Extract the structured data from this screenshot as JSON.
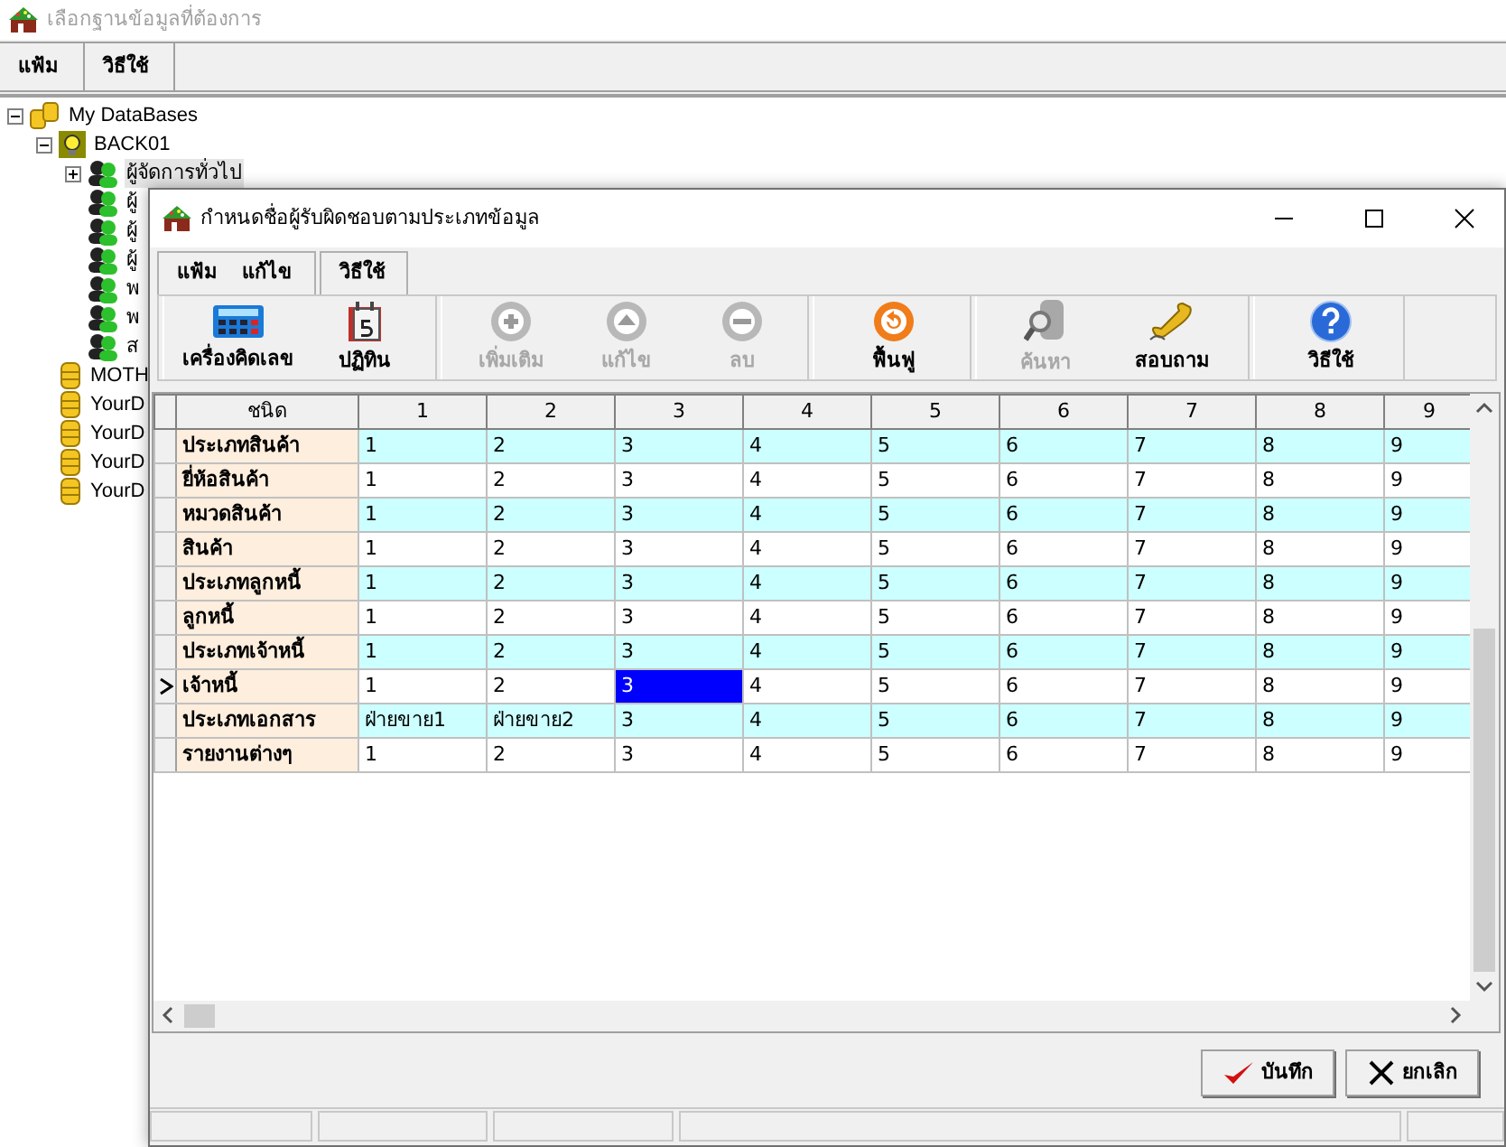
{
  "window": {
    "title": "เลือกฐานข้อมูลที่ต้องการ",
    "menu": [
      {
        "label": "แฟ้ม"
      },
      {
        "label": "วิธีใช้"
      }
    ]
  },
  "tree": [
    {
      "label": "My DataBases",
      "kind": "databases",
      "expanded": true,
      "children": [
        {
          "label": "BACK01",
          "kind": "server",
          "expanded": true,
          "children": [
            {
              "label": "ผู้จัดการทั่วไป",
              "kind": "user",
              "selected": true,
              "expanded": false
            },
            {
              "label": "ผู้",
              "kind": "user",
              "selected": false
            },
            {
              "label": "ผู้",
              "kind": "user",
              "selected": false
            },
            {
              "label": "ผู้",
              "kind": "user",
              "selected": false
            },
            {
              "label": "พ",
              "kind": "user",
              "selected": false
            },
            {
              "label": "พ",
              "kind": "user",
              "selected": false
            },
            {
              "label": "ส",
              "kind": "user",
              "selected": false
            }
          ]
        },
        {
          "label": "MOTH",
          "kind": "database"
        },
        {
          "label": "YourD",
          "kind": "database"
        },
        {
          "label": "YourD",
          "kind": "database"
        },
        {
          "label": "YourD",
          "kind": "database"
        },
        {
          "label": "YourD",
          "kind": "database"
        }
      ]
    }
  ],
  "dialog": {
    "title": "กำหนดชื่อผู้รับผิดชอบตามประเภทข้อมูล",
    "menu": [
      {
        "items": [
          "แฟ้ม",
          "แก้ไข"
        ]
      },
      {
        "items": [
          "วิธีใช้"
        ]
      }
    ],
    "toolbar": [
      [
        {
          "label": "เครื่องคิดเลข",
          "disabled": false
        },
        {
          "label": "ปฏิทิน",
          "disabled": false
        }
      ],
      [
        {
          "label": "เพิ่มเติม",
          "disabled": true
        },
        {
          "label": "แก้ไข",
          "disabled": true
        },
        {
          "label": "ลบ",
          "disabled": true
        }
      ],
      [
        {
          "label": "ฟื้นฟู",
          "disabled": false
        }
      ],
      [
        {
          "label": "ค้นหา",
          "disabled": true
        },
        {
          "label": "สอบถาม",
          "disabled": false
        }
      ],
      [
        {
          "label": "วิธีใช้",
          "disabled": false
        }
      ]
    ],
    "table": {
      "label_column": "ชนิด",
      "columns": [
        "1",
        "2",
        "3",
        "4",
        "5",
        "6",
        "7",
        "8",
        "9"
      ],
      "rows": [
        {
          "label": "ประเภทสินค้า",
          "current": false,
          "cells": [
            {
              "text": "1",
              "selected": false
            },
            {
              "text": "2",
              "selected": false
            },
            {
              "text": "3",
              "selected": false
            },
            {
              "text": "4",
              "selected": false
            },
            {
              "text": "5",
              "selected": false
            },
            {
              "text": "6",
              "selected": false
            },
            {
              "text": "7",
              "selected": false
            },
            {
              "text": "8",
              "selected": false
            },
            {
              "text": "9",
              "selected": false
            }
          ]
        },
        {
          "label": "ยี่ห้อสินค้า",
          "current": false,
          "cells": [
            {
              "text": "1",
              "selected": false
            },
            {
              "text": "2",
              "selected": false
            },
            {
              "text": "3",
              "selected": false
            },
            {
              "text": "4",
              "selected": false
            },
            {
              "text": "5",
              "selected": false
            },
            {
              "text": "6",
              "selected": false
            },
            {
              "text": "7",
              "selected": false
            },
            {
              "text": "8",
              "selected": false
            },
            {
              "text": "9",
              "selected": false
            }
          ]
        },
        {
          "label": "หมวดสินค้า",
          "current": false,
          "cells": [
            {
              "text": "1",
              "selected": false
            },
            {
              "text": "2",
              "selected": false
            },
            {
              "text": "3",
              "selected": false
            },
            {
              "text": "4",
              "selected": false
            },
            {
              "text": "5",
              "selected": false
            },
            {
              "text": "6",
              "selected": false
            },
            {
              "text": "7",
              "selected": false
            },
            {
              "text": "8",
              "selected": false
            },
            {
              "text": "9",
              "selected": false
            }
          ]
        },
        {
          "label": "สินค้า",
          "current": false,
          "cells": [
            {
              "text": "1",
              "selected": false
            },
            {
              "text": "2",
              "selected": false
            },
            {
              "text": "3",
              "selected": false
            },
            {
              "text": "4",
              "selected": false
            },
            {
              "text": "5",
              "selected": false
            },
            {
              "text": "6",
              "selected": false
            },
            {
              "text": "7",
              "selected": false
            },
            {
              "text": "8",
              "selected": false
            },
            {
              "text": "9",
              "selected": false
            }
          ]
        },
        {
          "label": "ประเภทลูกหนี้",
          "current": false,
          "cells": [
            {
              "text": "1",
              "selected": false
            },
            {
              "text": "2",
              "selected": false
            },
            {
              "text": "3",
              "selected": false
            },
            {
              "text": "4",
              "selected": false
            },
            {
              "text": "5",
              "selected": false
            },
            {
              "text": "6",
              "selected": false
            },
            {
              "text": "7",
              "selected": false
            },
            {
              "text": "8",
              "selected": false
            },
            {
              "text": "9",
              "selected": false
            }
          ]
        },
        {
          "label": "ลูกหนี้",
          "current": false,
          "cells": [
            {
              "text": "1",
              "selected": false
            },
            {
              "text": "2",
              "selected": false
            },
            {
              "text": "3",
              "selected": false
            },
            {
              "text": "4",
              "selected": false
            },
            {
              "text": "5",
              "selected": false
            },
            {
              "text": "6",
              "selected": false
            },
            {
              "text": "7",
              "selected": false
            },
            {
              "text": "8",
              "selected": false
            },
            {
              "text": "9",
              "selected": false
            }
          ]
        },
        {
          "label": "ประเภทเจ้าหนี้",
          "current": false,
          "cells": [
            {
              "text": "1",
              "selected": false
            },
            {
              "text": "2",
              "selected": false
            },
            {
              "text": "3",
              "selected": false
            },
            {
              "text": "4",
              "selected": false
            },
            {
              "text": "5",
              "selected": false
            },
            {
              "text": "6",
              "selected": false
            },
            {
              "text": "7",
              "selected": false
            },
            {
              "text": "8",
              "selected": false
            },
            {
              "text": "9",
              "selected": false
            }
          ]
        },
        {
          "label": "เจ้าหนี้",
          "current": true,
          "cells": [
            {
              "text": "1",
              "selected": false
            },
            {
              "text": "2",
              "selected": false
            },
            {
              "text": "3",
              "selected": true
            },
            {
              "text": "4",
              "selected": false
            },
            {
              "text": "5",
              "selected": false
            },
            {
              "text": "6",
              "selected": false
            },
            {
              "text": "7",
              "selected": false
            },
            {
              "text": "8",
              "selected": false
            },
            {
              "text": "9",
              "selected": false
            }
          ]
        },
        {
          "label": "ประเภทเอกสาร",
          "current": false,
          "cells": [
            {
              "text": "ฝ่ายขาย1",
              "selected": false
            },
            {
              "text": "ฝ่ายขาย2",
              "selected": false
            },
            {
              "text": "3",
              "selected": false
            },
            {
              "text": "4",
              "selected": false
            },
            {
              "text": "5",
              "selected": false
            },
            {
              "text": "6",
              "selected": false
            },
            {
              "text": "7",
              "selected": false
            },
            {
              "text": "8",
              "selected": false
            },
            {
              "text": "9",
              "selected": false
            }
          ]
        },
        {
          "label": "รายงานต่างๆ",
          "current": false,
          "cells": [
            {
              "text": "1",
              "selected": false
            },
            {
              "text": "2",
              "selected": false
            },
            {
              "text": "3",
              "selected": false
            },
            {
              "text": "4",
              "selected": false
            },
            {
              "text": "5",
              "selected": false
            },
            {
              "text": "6",
              "selected": false
            },
            {
              "text": "7",
              "selected": false
            },
            {
              "text": "8",
              "selected": false
            },
            {
              "text": "9",
              "selected": false
            }
          ]
        }
      ]
    },
    "buttons": [
      {
        "label": "บันทึก"
      },
      {
        "label": "ยกเลิก"
      }
    ]
  }
}
